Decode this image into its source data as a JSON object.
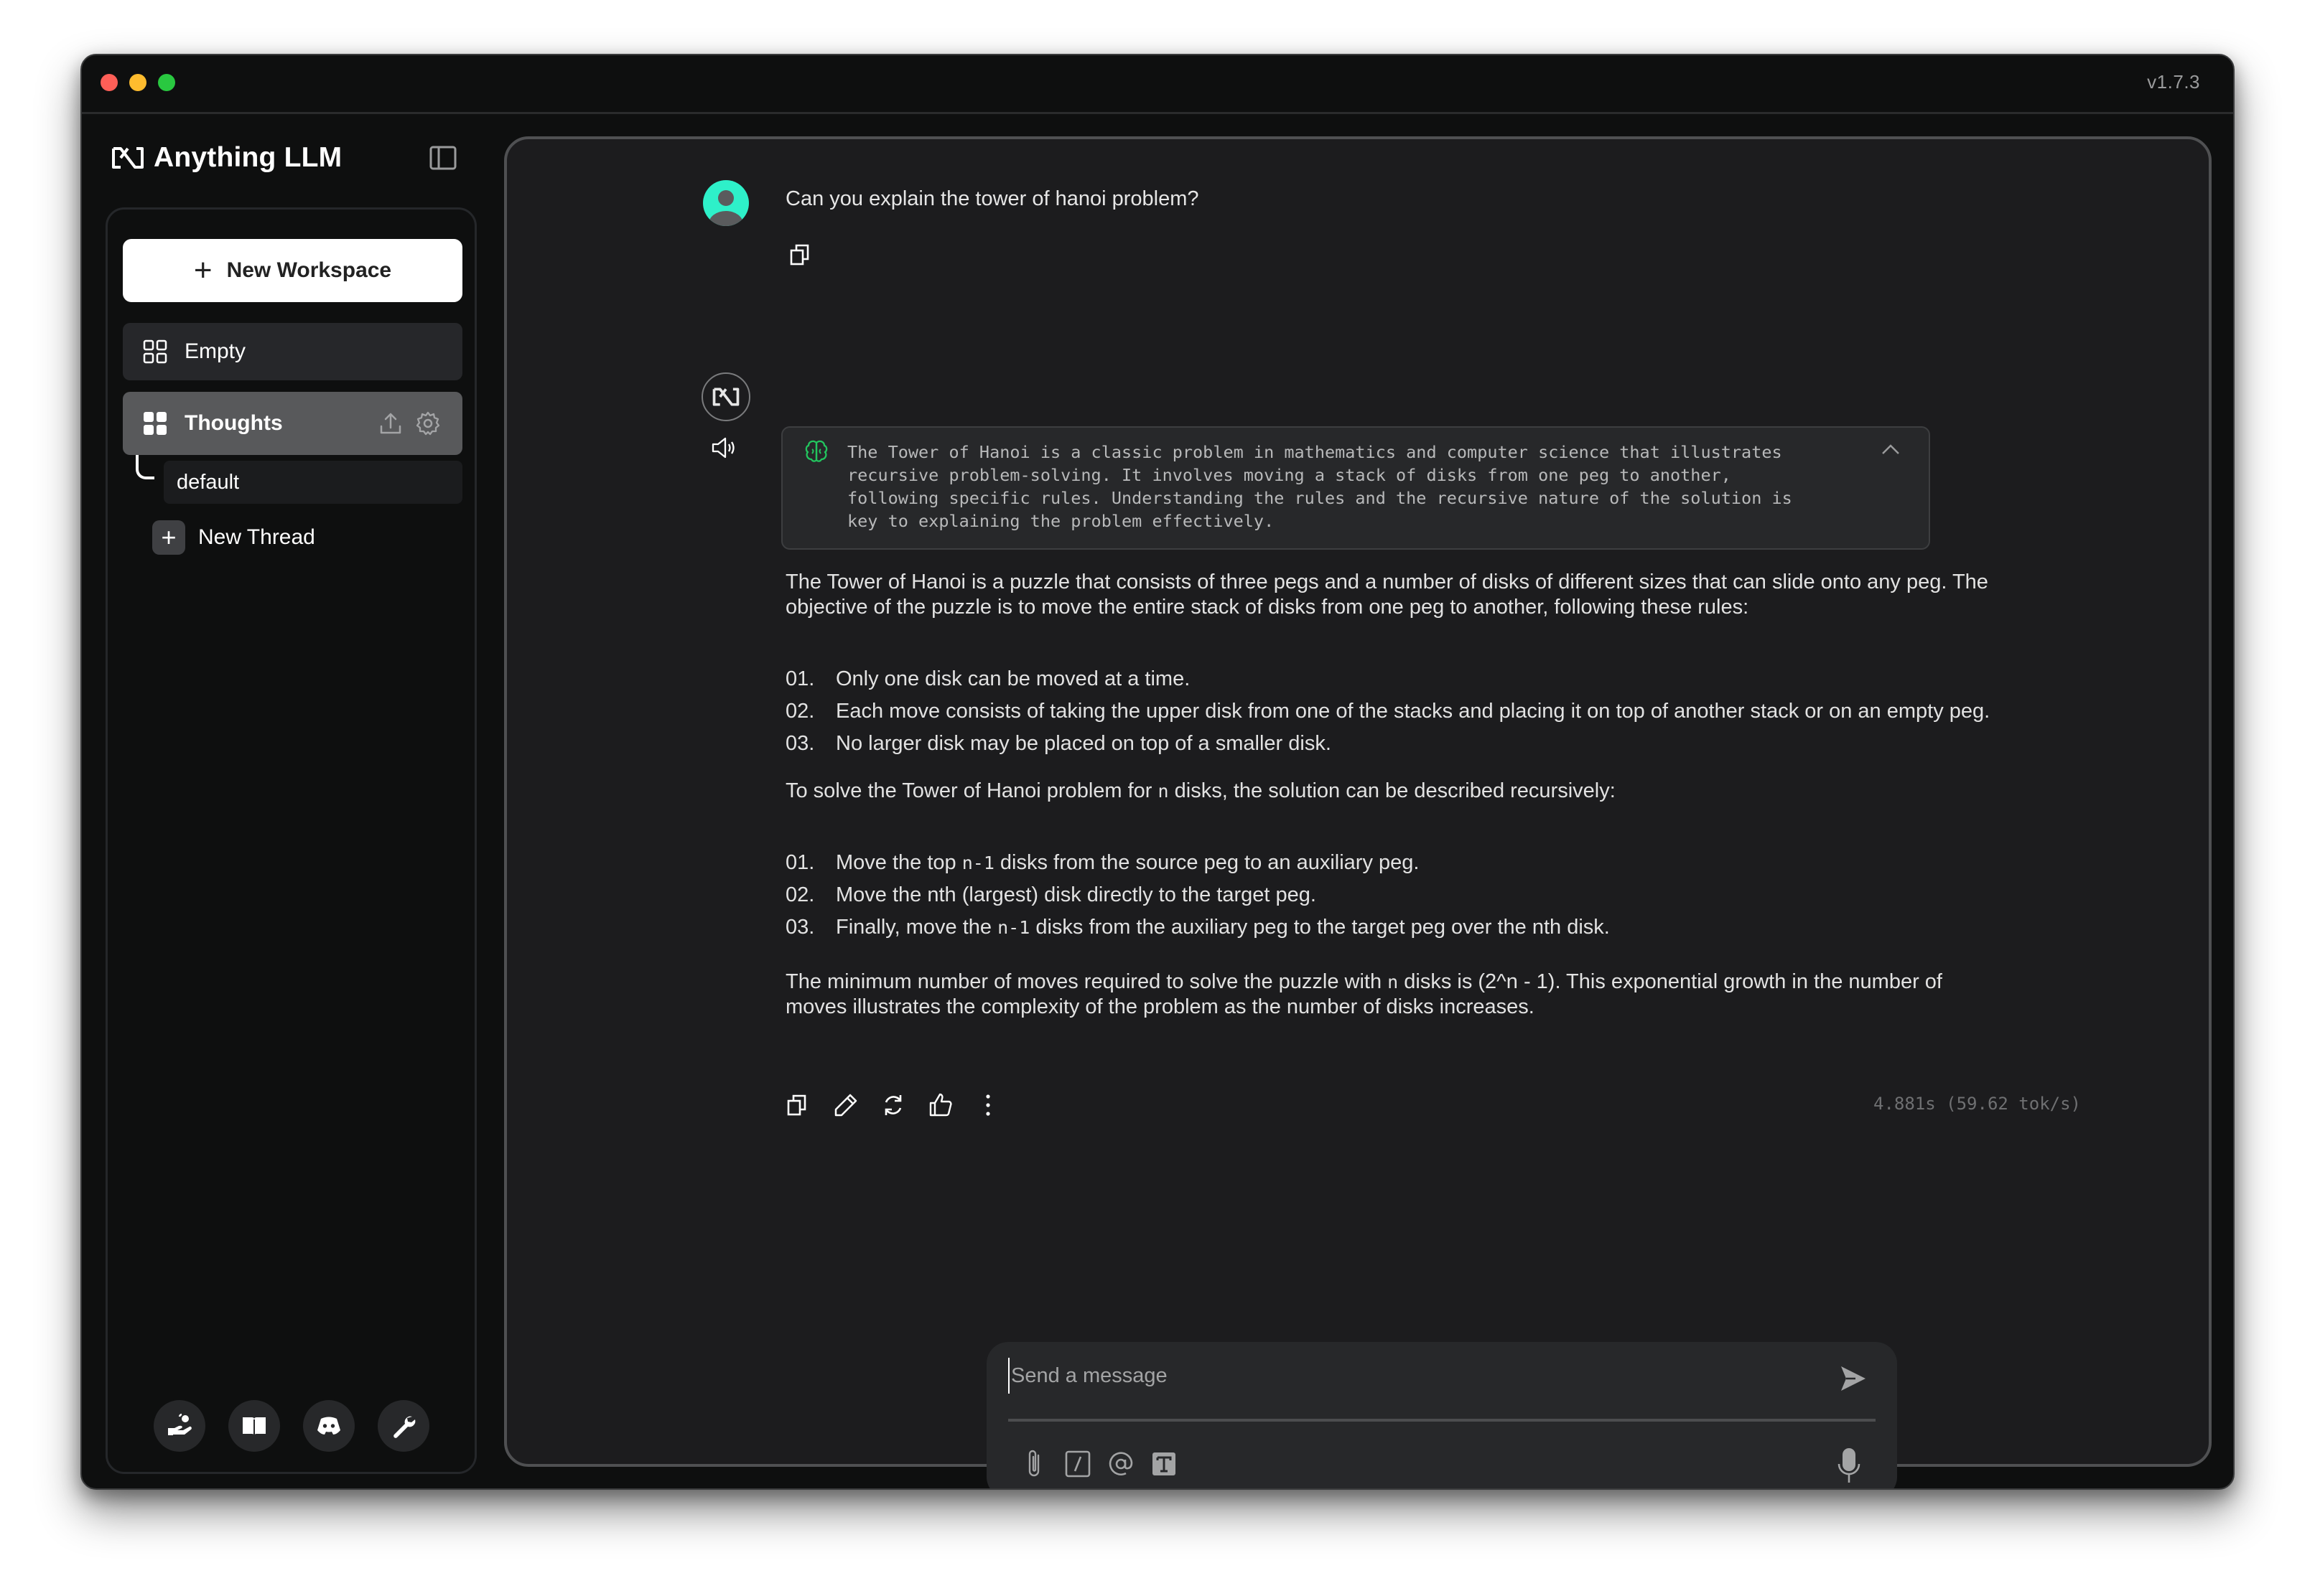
{
  "window": {
    "version": "v1.7.3"
  },
  "sidebar": {
    "app_name": "Anything LLM",
    "new_workspace_label": "New Workspace",
    "workspaces": [
      {
        "name": "Empty",
        "active": false
      },
      {
        "name": "Thoughts",
        "active": true
      }
    ],
    "threads": [
      {
        "name": "default"
      }
    ],
    "new_thread_label": "New Thread",
    "footer_icons": [
      "community-hub-icon",
      "docs-book-icon",
      "discord-icon",
      "settings-wrench-icon"
    ]
  },
  "chat": {
    "user_message": "Can you explain the tower of hanoi problem?",
    "thought": "The Tower of Hanoi is a classic problem in mathematics and computer science that illustrates\nrecursive problem-solving. It involves moving a stack of disks from one peg to another,\nfollowing specific rules. Understanding the rules and the recursive nature of the solution is\nkey to explaining the problem effectively.",
    "response": {
      "intro": "The Tower of Hanoi is a puzzle that consists of three pegs and a number of disks of different sizes that can slide onto any peg. The objective of the puzzle is to move the entire stack of disks from one peg to another, following these rules:",
      "rules": [
        {
          "num": "01.",
          "text": "Only one disk can be moved at a time."
        },
        {
          "num": "02.",
          "text": "Each move consists of taking the upper disk from one of the stacks and placing it on top of another stack or on an empty peg."
        },
        {
          "num": "03.",
          "text": "No larger disk may be placed on top of a smaller disk."
        }
      ],
      "solve_intro_pre": "To solve the Tower of Hanoi problem for ",
      "solve_intro_code": "n",
      "solve_intro_post": " disks, the solution can be described recursively:",
      "steps": [
        {
          "num": "01.",
          "pre": "Move the top ",
          "code": "n-1",
          "post": " disks from the source peg to an auxiliary peg."
        },
        {
          "num": "02.",
          "pre": "Move the nth (largest) disk directly to the target peg.",
          "code": "",
          "post": ""
        },
        {
          "num": "03.",
          "pre": "Finally, move the ",
          "code": "n-1",
          "post": " disks from the auxiliary peg to the target peg over the nth disk."
        }
      ],
      "conclusion_pre": "The minimum number of moves required to solve the puzzle with ",
      "conclusion_code": "n",
      "conclusion_post": " disks is (2^n - 1). This exponential growth in the number of moves illustrates the complexity of the problem as the number of disks increases."
    },
    "timing": "4.881s (59.62 tok/s)"
  },
  "input": {
    "placeholder": "Send a message",
    "value": ""
  },
  "colors": {
    "accent_teal": "#2ef0c9",
    "thought_icon_green": "#22c55e"
  }
}
